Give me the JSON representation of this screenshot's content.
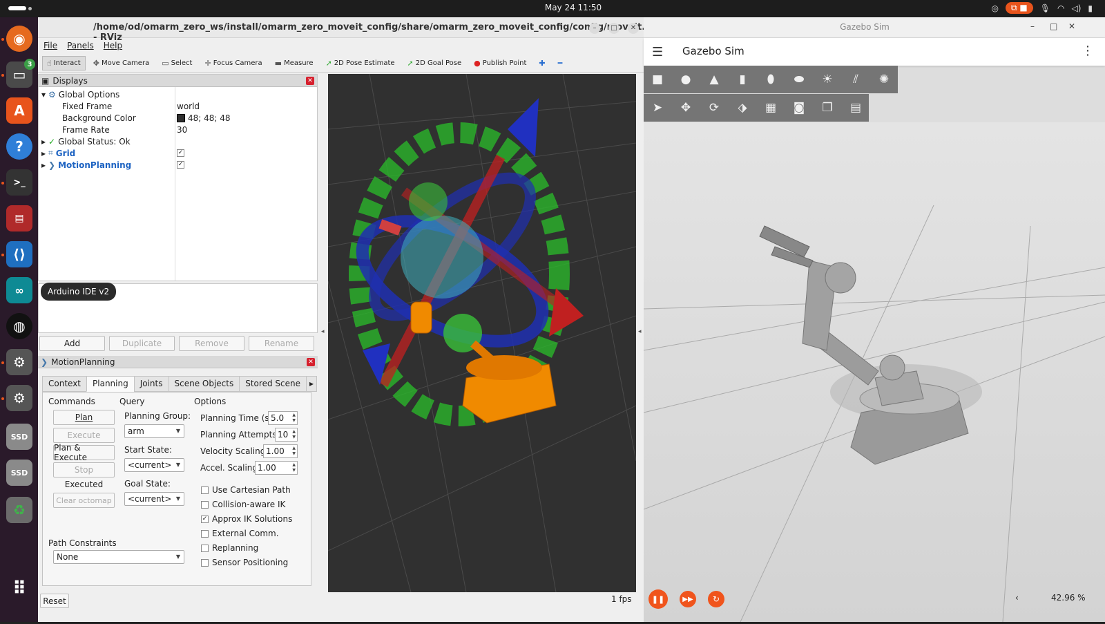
{
  "system": {
    "clock": "May 24  11:50"
  },
  "dock": {
    "files_badge": "3",
    "ssd1": "SSD",
    "ssd2": "SSD"
  },
  "rviz": {
    "title": "/home/od/omarm_zero_ws/install/omarm_zero_moveit_config/share/omarm_zero_moveit_config/config/moveit.rviz* - RViz",
    "menu": [
      "File",
      "Panels",
      "Help"
    ],
    "tools": [
      "Interact",
      "Move Camera",
      "Select",
      "Focus Camera",
      "Measure",
      "2D Pose Estimate",
      "2D Goal Pose",
      "Publish Point"
    ],
    "displays": {
      "title": "Displays",
      "global_options": "Global Options",
      "fixed_frame_label": "Fixed Frame",
      "fixed_frame_value": "world",
      "bg_color_label": "Background Color",
      "bg_color_value": "48; 48; 48",
      "bg_color_swatch": "#303030",
      "frame_rate_label": "Frame Rate",
      "frame_rate_value": "30",
      "global_status": "Global Status: Ok",
      "grid": "Grid",
      "motion_planning": "MotionPlanning"
    },
    "tooltip": "Arduino IDE v2",
    "buttons": {
      "add": "Add",
      "duplicate": "Duplicate",
      "remove": "Remove",
      "rename": "Rename"
    },
    "mp": {
      "title": "MotionPlanning",
      "tabs": [
        "Context",
        "Planning",
        "Joints",
        "Scene Objects",
        "Stored Scene"
      ],
      "commands": "Commands",
      "query": "Query",
      "options": "Options",
      "plan": "Plan",
      "execute": "Execute",
      "plan_execute": "Plan & Execute",
      "stop": "Stop",
      "status": "Executed",
      "clear_octomap": "Clear octomap",
      "planning_group_label": "Planning Group:",
      "planning_group": "arm",
      "start_state_label": "Start State:",
      "start_state": "<current>",
      "goal_state_label": "Goal State:",
      "goal_state": "<current>",
      "planning_time_label": "Planning Time (s):",
      "planning_time": "5.0",
      "planning_attempts_label": "Planning Attempts:",
      "planning_attempts": "10",
      "velocity_label": "Velocity Scaling:",
      "velocity": "1.00",
      "accel_label": "Accel. Scaling:",
      "accel": "1.00",
      "checks": [
        {
          "label": "Use Cartesian Path",
          "checked": false
        },
        {
          "label": "Collision-aware IK",
          "checked": false
        },
        {
          "label": "Approx IK Solutions",
          "checked": true
        },
        {
          "label": "External Comm.",
          "checked": false
        },
        {
          "label": "Replanning",
          "checked": false
        },
        {
          "label": "Sensor Positioning",
          "checked": false
        }
      ],
      "path_constraints_label": "Path Constraints",
      "path_constraints": "None"
    },
    "reset": "Reset",
    "fps": "1 fps"
  },
  "gazebo": {
    "window_title": "Gazebo Sim",
    "header_title": "Gazebo Sim",
    "zoom": "42.96 %"
  },
  "colors": {
    "accent": "#f0541c",
    "rviz_bg": "#303030",
    "link": "#1d63c2"
  }
}
